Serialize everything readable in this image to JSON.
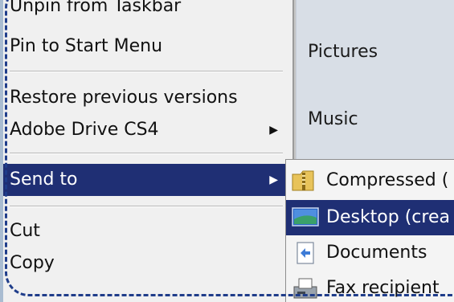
{
  "context_menu": {
    "items": [
      {
        "label": "Unpin from Taskbar"
      },
      {
        "label": "Pin to Start Menu"
      },
      {
        "label": "Restore previous versions"
      },
      {
        "label": "Adobe Drive CS4",
        "arrow": "▶"
      },
      {
        "label": "Send to",
        "arrow": "▶"
      },
      {
        "label": "Cut"
      },
      {
        "label": "Copy"
      }
    ]
  },
  "start_panel": {
    "items": [
      {
        "label": "Pictures"
      },
      {
        "label": "Music"
      }
    ]
  },
  "send_to_submenu": {
    "items": [
      {
        "label": "Compressed (",
        "icon": "zip-folder-icon"
      },
      {
        "label": "Desktop (crea",
        "icon": "desktop-icon"
      },
      {
        "label": "Documents",
        "icon": "documents-icon"
      },
      {
        "label": "Fax recipient",
        "icon": "fax-icon"
      }
    ]
  },
  "colors": {
    "highlight": "#1f2f74",
    "menu_bg": "#f0f0f0",
    "outline": "#1f3d8a"
  }
}
